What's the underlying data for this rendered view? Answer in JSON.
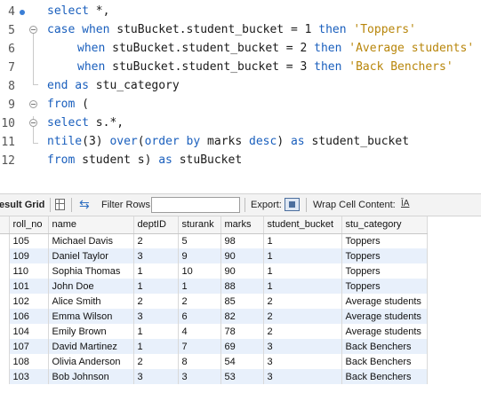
{
  "editor": {
    "lines": [
      {
        "n": "4"
      },
      {
        "n": "5"
      },
      {
        "n": "6"
      },
      {
        "n": "7"
      },
      {
        "n": "8"
      },
      {
        "n": "9"
      },
      {
        "n": "10"
      },
      {
        "n": "11"
      },
      {
        "n": "12"
      }
    ],
    "tokens": {
      "l4": {
        "a": "select",
        "b": " *,"
      },
      "l5": {
        "a": "case when",
        "b": " stuBucket.student_bucket = 1 ",
        "c": "then",
        "d": " ",
        "e": "'Toppers'"
      },
      "l6": {
        "a": "when",
        "b": " stuBucket.student_bucket = 2 ",
        "c": "then",
        "d": " ",
        "e": "'Average students'"
      },
      "l7": {
        "a": "when",
        "b": " stuBucket.student_bucket = 3 ",
        "c": "then",
        "d": " ",
        "e": "'Back Benchers'"
      },
      "l8": {
        "a": "end as",
        "b": " stu_category"
      },
      "l9": {
        "a": "from",
        "b": " ("
      },
      "l10": {
        "a": "select",
        "b": " s.*,"
      },
      "l11": {
        "a": "ntile",
        "b": "(3) ",
        "c": "over",
        "d": "(",
        "e": "order by",
        "f": " marks ",
        "g": "desc",
        "h": ") ",
        "i": "as",
        "j": " student_bucket"
      },
      "l12": {
        "a": "from",
        "b": " student s) ",
        "c": "as",
        "d": " stuBucket"
      }
    }
  },
  "toolbar": {
    "result_grid_label": "esult Grid",
    "filter_rows_label": "Filter Rows:",
    "filter_value": "",
    "export_label": "Export:",
    "wrap_label": "Wrap Cell Content:",
    "grid_icon": "grid-icon",
    "refresh_icon": "refresh-icon",
    "export_icon": "export-icon",
    "wrap_icon": "wrap-text-icon"
  },
  "grid": {
    "columns": [
      "roll_no",
      "name",
      "deptID",
      "sturank",
      "marks",
      "student_bucket",
      "stu_category"
    ],
    "rows": [
      [
        "105",
        "Michael Davis",
        "2",
        "5",
        "98",
        "1",
        "Toppers"
      ],
      [
        "109",
        "Daniel Taylor",
        "3",
        "9",
        "90",
        "1",
        "Toppers"
      ],
      [
        "110",
        "Sophia Thomas",
        "1",
        "10",
        "90",
        "1",
        "Toppers"
      ],
      [
        "101",
        "John Doe",
        "1",
        "1",
        "88",
        "1",
        "Toppers"
      ],
      [
        "102",
        "Alice Smith",
        "2",
        "2",
        "85",
        "2",
        "Average students"
      ],
      [
        "106",
        "Emma Wilson",
        "3",
        "6",
        "82",
        "2",
        "Average students"
      ],
      [
        "104",
        "Emily Brown",
        "1",
        "4",
        "78",
        "2",
        "Average students"
      ],
      [
        "107",
        "David Martinez",
        "1",
        "7",
        "69",
        "3",
        "Back Benchers"
      ],
      [
        "108",
        "Olivia Anderson",
        "2",
        "8",
        "54",
        "3",
        "Back Benchers"
      ],
      [
        "103",
        "Bob Johnson",
        "3",
        "3",
        "53",
        "3",
        "Back Benchers"
      ]
    ]
  },
  "colors": {
    "keyword": "#1a5fbd",
    "string": "#b8860b",
    "row_alt": "#e8f0fb"
  }
}
